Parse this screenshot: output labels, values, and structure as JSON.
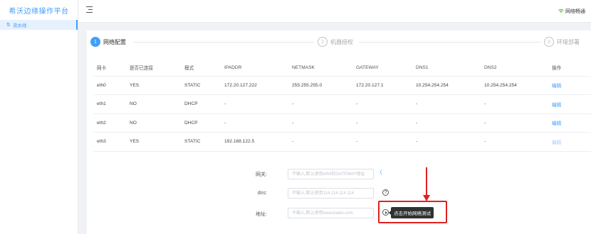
{
  "sidebar": {
    "brand": "希沃边缘操作平台",
    "items": [
      {
        "icon": "pipeline-icon",
        "label": "流水线"
      }
    ]
  },
  "header": {
    "network_status": "网络畅通"
  },
  "steps": [
    {
      "number": "1",
      "label": "网络配置",
      "active": true
    },
    {
      "number": "2",
      "label": "机器授权",
      "active": false
    },
    {
      "number": "3",
      "label": "环境部署",
      "active": false
    }
  ],
  "table": {
    "columns": [
      "网卡",
      "是否已连接",
      "模式",
      "IPADDR",
      "NETMASK",
      "GATEWAY",
      "DNS1",
      "DNS2",
      "操作"
    ],
    "rows": [
      {
        "nic": "eth0",
        "connected": "YES",
        "mode": "STATIC",
        "ipaddr": "172.20.127.222",
        "netmask": "255.255.255.0",
        "gateway": "172.20.127.1",
        "dns1": "10.254.254.254",
        "dns2": "10.254.254.254",
        "action": "编辑"
      },
      {
        "nic": "eth1",
        "connected": "NO",
        "mode": "DHCP",
        "ipaddr": "-",
        "netmask": "-",
        "gateway": "-",
        "dns1": "-",
        "dns2": "-",
        "action": "编辑"
      },
      {
        "nic": "eth2",
        "connected": "NO",
        "mode": "DHCP",
        "ipaddr": "-",
        "netmask": "-",
        "gateway": "-",
        "dns1": "-",
        "dns2": "-",
        "action": "编辑"
      },
      {
        "nic": "eth3",
        "connected": "YES",
        "mode": "STATIC",
        "ipaddr": "192.168.122.5",
        "netmask": "-",
        "gateway": "-",
        "dns1": "-",
        "dns2": "-",
        "action": "编辑"
      }
    ]
  },
  "form": {
    "gateway": {
      "label": "网关:",
      "placeholder": "不输入,默认使用eth0的GATEWAY地址",
      "value": ""
    },
    "dns": {
      "label": "dns:",
      "placeholder": "不输入,默认使用114.114.114.114",
      "value": ""
    },
    "address": {
      "label": "地址:",
      "placeholder": "不输入,默认使用www.baidu.com",
      "value": ""
    }
  },
  "tooltip": "点击开始网络测试",
  "colors": {
    "accent": "#409eff",
    "status_ok": "#67c23a",
    "annotation": "#e02020"
  }
}
